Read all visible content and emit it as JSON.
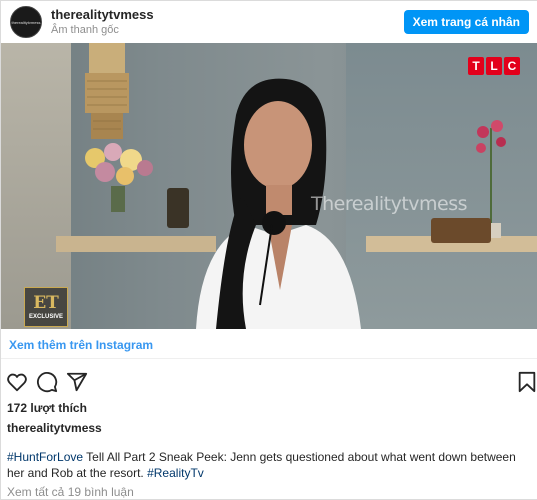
{
  "header": {
    "username": "therealitytvmess",
    "subtitle": "Âm thanh gốc",
    "avatar_text": "therealitytvmess",
    "profile_button": "Xem trang cá nhân"
  },
  "media": {
    "network_logo": [
      "T",
      "L",
      "C"
    ],
    "watermark": "Therealitytvmess",
    "corner_logo": "ET",
    "corner_logo_sub": "EXCLUSIVE"
  },
  "footer": {
    "more_link": "Xem thêm trên Instagram",
    "actions": {
      "like_icon": "heart-icon",
      "comment_icon": "comment-icon",
      "share_icon": "share-icon",
      "save_icon": "bookmark-icon"
    },
    "likes": "172 lượt thích",
    "caption_user": "therealitytvmess",
    "caption_tag1": "#HuntForLove",
    "caption_text": " Tell All Part 2 Sneak Peek: Jenn gets questioned about what went down between her and Rob at the resort. ",
    "caption_tag2": "#RealityTv",
    "comments": "Xem tất cả 19 bình luận"
  },
  "colors": {
    "accent": "#0095f6",
    "link": "#3897f0",
    "tlc_red": "#e3001b"
  }
}
